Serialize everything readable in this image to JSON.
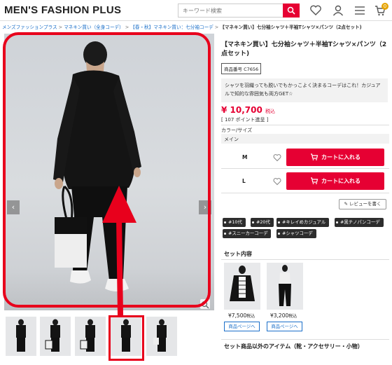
{
  "header": {
    "logo": "MEN'S FASHION PLUS",
    "search_placeholder": "キーワード検索",
    "cart_count": "0",
    "icons": [
      "search-icon",
      "heart-icon",
      "user-icon",
      "menu-icon",
      "cart-icon"
    ]
  },
  "breadcrumb": {
    "items": [
      "メンズファッションプラス",
      "マネキン買い（全身コーデ）",
      "【春・秋】マネキン買い：七分袖コーデ"
    ],
    "separator": ">",
    "current": "【マネキン買い】七分袖シャツ＋半袖Tシャツ×パンツ（2点セット)"
  },
  "product": {
    "title": "【マネキン買い】七分袖シャツ＋半袖Tシャツ×パンツ（2点セット)",
    "code": "商品番号 C7656",
    "description": "シャツを羽織っても脱いでもかっこよく決まるコーデはこれ！カジュアルで知的な雰囲気も両方GET☆",
    "price": "¥ 10,700",
    "price_tax": "税込",
    "points": "[ 107 ポイント進呈 ]",
    "color_size_label": "カラー/サイズ",
    "color": "メイン",
    "sizes": [
      {
        "label": "M",
        "button": "カートに入れる"
      },
      {
        "label": "L",
        "button": "カートに入れる"
      }
    ],
    "review_button": "レビューを書く",
    "tags": [
      "#10代",
      "#20代",
      "#キレイめカジュアル",
      "#黒チノパンコーデ",
      "#スニーカーコーデ",
      "#シャツコーデ"
    ]
  },
  "gallery": {
    "prev_arrow": "‹",
    "next_arrow": "›",
    "thumbnail_count": 5,
    "selected_thumbnail": 4
  },
  "set_contents": {
    "title": "セット内容",
    "items": [
      {
        "price": "¥7,500",
        "tax": "税込",
        "link": "商品ページへ"
      },
      {
        "price": "¥3,200",
        "tax": "税込",
        "link": "商品ページへ"
      }
    ]
  },
  "other_items": {
    "title": "セット商品以外のアイテム（靴・アクセサリー・小物）"
  },
  "colors": {
    "brand_red": "#e60033",
    "annotation_red": "#e8001c",
    "link_blue": "#1a6fc9",
    "tag_dark": "#2d2d2d",
    "badge_orange": "#e6a400"
  }
}
